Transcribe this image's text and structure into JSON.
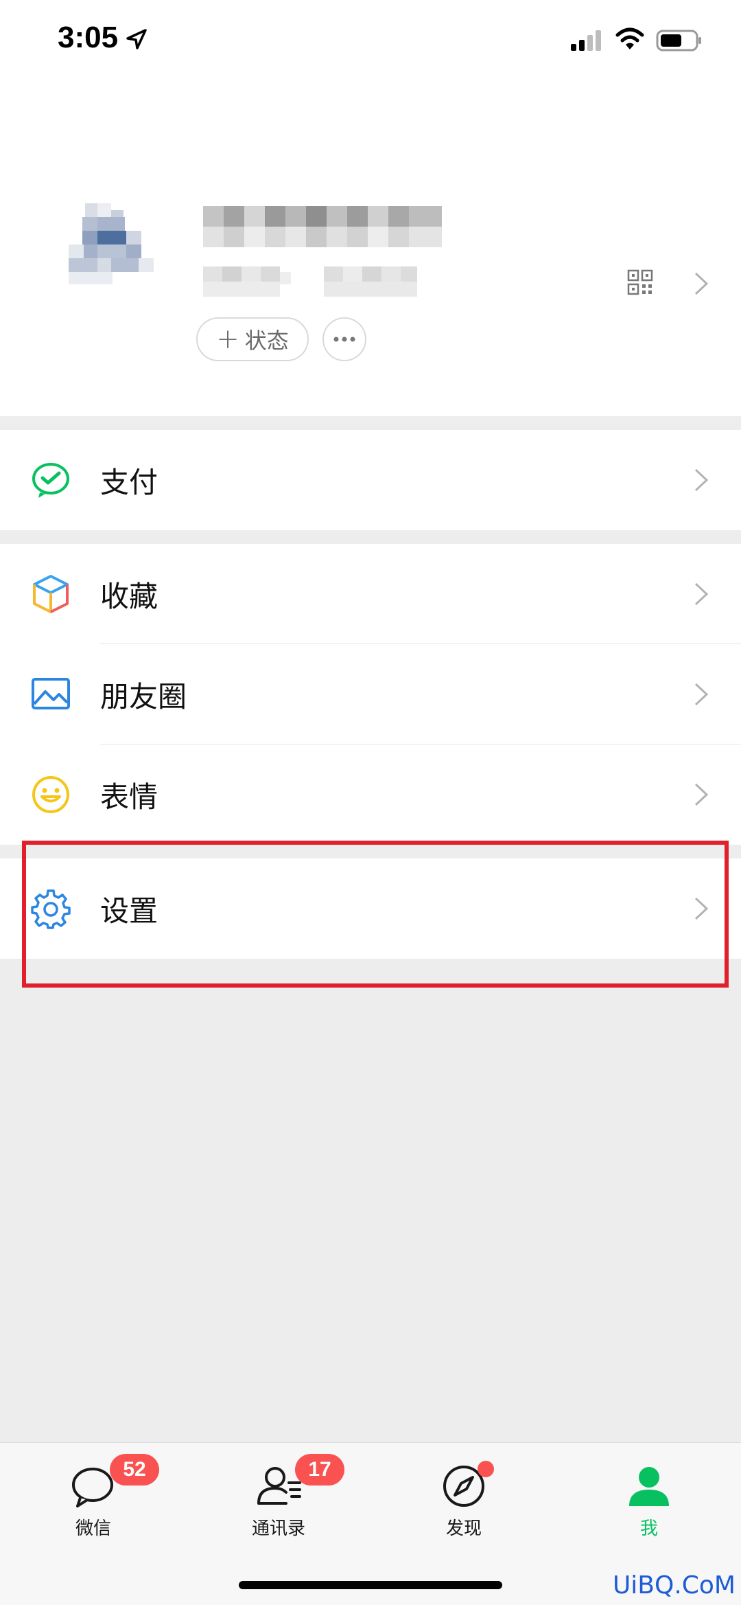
{
  "status_bar": {
    "time": "3:05"
  },
  "profile": {
    "status_button_plus": "+",
    "status_button_label": "状态"
  },
  "menu": {
    "pay": {
      "label": "支付",
      "icon": "wechat-pay-icon"
    },
    "favorites": {
      "label": "收藏",
      "icon": "cube-icon"
    },
    "moments": {
      "label": "朋友圈",
      "icon": "picture-icon"
    },
    "stickers": {
      "label": "表情",
      "icon": "smiley-icon"
    },
    "settings": {
      "label": "设置",
      "icon": "gear-icon"
    }
  },
  "tabs": [
    {
      "label": "微信",
      "badge": "52",
      "icon": "chat-bubble-icon"
    },
    {
      "label": "通讯录",
      "badge": "17",
      "icon": "contacts-icon"
    },
    {
      "label": "发现",
      "icon": "compass-icon"
    },
    {
      "label": "我",
      "icon": "person-icon",
      "active": true
    }
  ],
  "colors": {
    "brand_green": "#07c160",
    "badge_red": "#fa5151",
    "highlight_red": "#e0202a"
  },
  "watermark": "UiBQ.CoM"
}
